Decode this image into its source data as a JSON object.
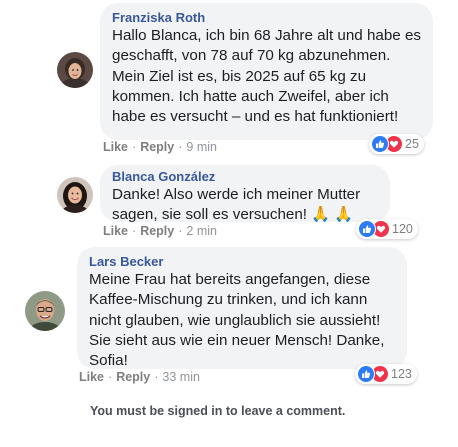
{
  "comments": [
    {
      "author": "Franziska Roth",
      "text": "Hallo Blanca, ich bin 68 Jahre alt und habe es geschafft, von 78 auf 70 kg abzunehmen. Mein Ziel ist es, bis 2025 auf 65 kg zu kommen. Ich hatte auch Zweifel, aber ich habe es versucht – und es hat funktioniert!",
      "like_label": "Like",
      "reply_label": "Reply",
      "time": "9 min",
      "reaction_count": "25",
      "reaction_icons": [
        "like-icon",
        "love-icon"
      ]
    },
    {
      "author": "Blanca González",
      "text": "Danke! Also werde ich meiner Mutter sagen, sie soll es versuchen! 🙏 🙏",
      "like_label": "Like",
      "reply_label": "Reply",
      "time": "2 min",
      "reaction_count": "120",
      "reaction_icons": [
        "like-icon",
        "love-icon"
      ]
    },
    {
      "author": "Lars Becker",
      "text": "Meine Frau hat bereits angefangen, diese Kaffee-Mischung zu trinken, und ich kann nicht glauben, wie unglaublich sie aussieht! Sie sieht aus wie ein neuer Mensch! Danke, Sofia!",
      "like_label": "Like",
      "reply_label": "Reply",
      "time": "33 min",
      "reaction_count": "123",
      "reaction_icons": [
        "like-icon",
        "love-icon"
      ]
    }
  ],
  "footer": {
    "notice": "You must be signed in to leave a comment."
  },
  "colors": {
    "author": "#385898",
    "bubble": "#f2f3f5",
    "like": "#2d7cf6",
    "love": "#f0334a"
  }
}
